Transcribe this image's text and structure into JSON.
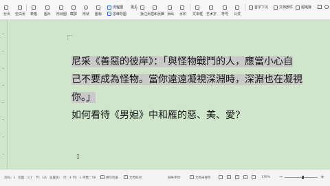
{
  "toolbar": {
    "items": [
      "分页",
      "空白页",
      "表格",
      "图片",
      "形状图",
      "截屏",
      "形状",
      "图标",
      "流程图",
      "思维导图",
      "更多",
      "批注",
      "页眉和页脚",
      "页码",
      "水印",
      "文本框",
      "艺术字",
      "符号",
      "公式"
    ],
    "right_labels": [
      "首字下沉",
      "文档部件",
      "超链接"
    ]
  },
  "document": {
    "line1_selected": "尼采《善惡的彼岸》：「與怪物戰鬥的人，應當小心自",
    "line2_selected": "己不要成為怪物。當你遠遠凝視深淵時，深淵也在凝視",
    "line3_selected": "你。」",
    "line4": "如何看待《男妲》中和雁的惡、美、愛?"
  },
  "statusbar": {
    "left_items": [
      "页码：1",
      "页面：1/1",
      "节：1/1",
      "设置值：",
      "行：4",
      "列：1",
      "字数：58",
      "拼写检查",
      "文档校对"
    ],
    "right_items": [
      "缺失字体",
      "文档未保存"
    ],
    "zoom": "170%",
    "zoom_fraction": 0.55
  },
  "colors": {
    "page_bg": "#cfe6cb",
    "selection": "#c9c9c9"
  }
}
